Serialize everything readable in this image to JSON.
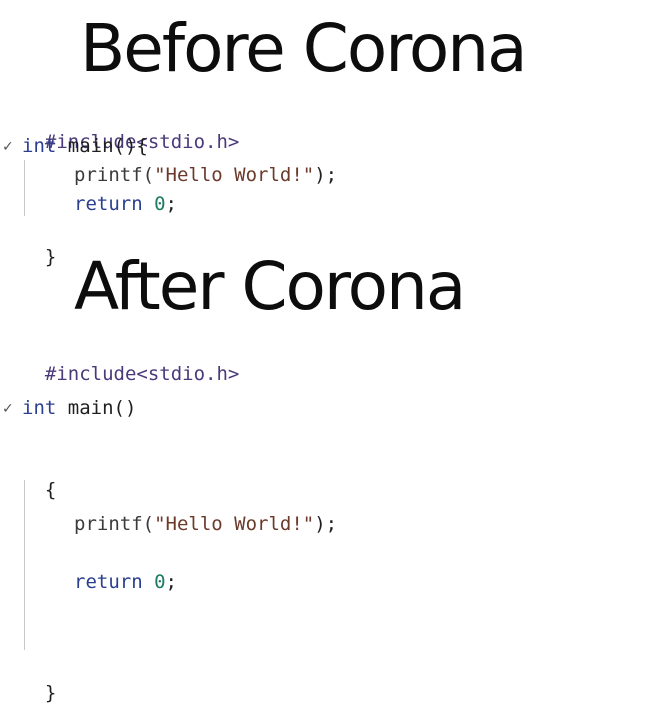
{
  "before": {
    "title": "Before Corona",
    "lines": {
      "include": "#include<stdio.h>",
      "main_kw": "int",
      "main_rest": " main(){",
      "printf_fn": "printf(",
      "printf_str": "\"Hello World!\"",
      "printf_end": ");",
      "return_kw": "return",
      "return_val": "0",
      "return_end": ";",
      "close": "}"
    }
  },
  "after": {
    "title": "After Corona",
    "lines": {
      "include": "#include<stdio.h>",
      "main_kw": "int",
      "main_rest": " main()",
      "open": "{",
      "printf_fn": "printf(",
      "printf_str": "\"Hello World!\"",
      "printf_end": ");",
      "return_kw": "return",
      "return_val": "0",
      "return_end": ";",
      "close": "}"
    }
  },
  "icons": {
    "fold_marker": "chevron-down-icon"
  },
  "colors": {
    "background": "#ffffff",
    "heading": "#0d0d0d",
    "keyword": "#2a3f8f",
    "string": "#6b3a2a",
    "number": "#1d7a64",
    "preprocessor": "#4a3a7a"
  }
}
